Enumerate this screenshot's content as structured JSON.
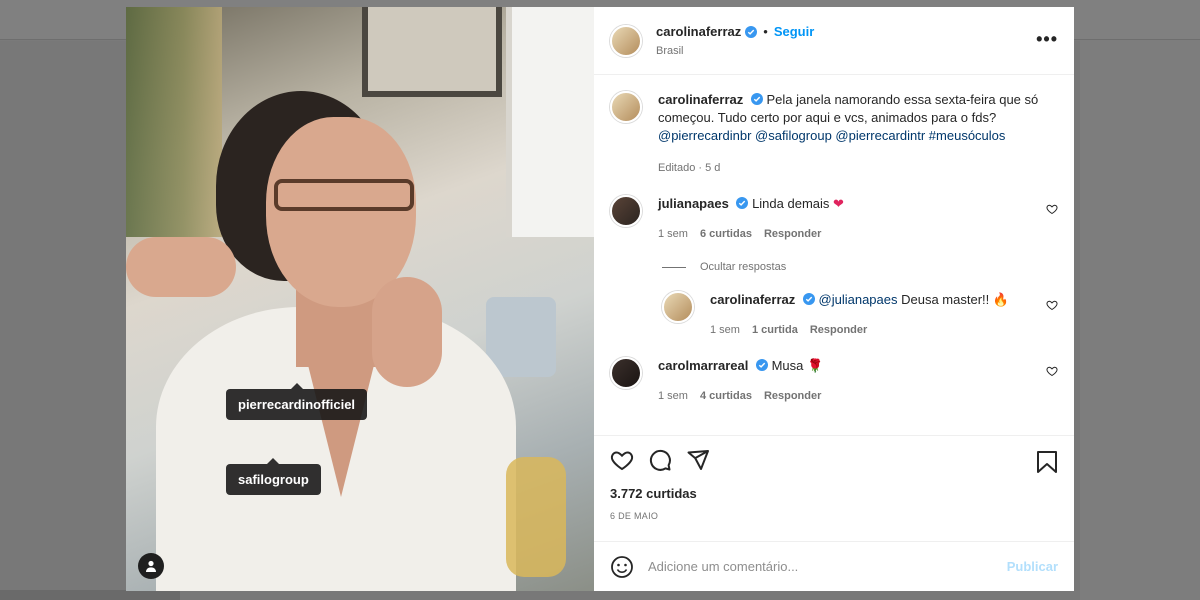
{
  "post": {
    "username": "carolinaferraz",
    "follow_label": "Seguir",
    "location": "Brasil",
    "more_label": "•••",
    "caption": "Pela janela namorando essa sexta-feira que só começou. Tudo certo por aqui e vcs, animados para o fds?",
    "caption_mentions": "@pierrecardinbr @safilogroup @pierrecardintr #meusóculos",
    "caption_meta": "Editado · 5 d",
    "tags": [
      {
        "label": "pierrecardinofficiel"
      },
      {
        "label": "safilogroup"
      }
    ]
  },
  "comments": [
    {
      "username": "julianapaes",
      "text": "Linda demais",
      "emoji": "❤",
      "time": "1 sem",
      "likes": "6 curtidas",
      "reply": "Responder",
      "hide_replies": "Ocultar respostas",
      "replies": [
        {
          "username": "carolinaferraz",
          "mention": "@julianapaes",
          "text": " Deusa master!! 🔥",
          "time": "1 sem",
          "likes": "1 curtida",
          "reply": "Responder"
        }
      ]
    },
    {
      "username": "carolmarrareal",
      "text": "Musa 🌹",
      "time": "1 sem",
      "likes": "4 curtidas",
      "reply": "Responder"
    }
  ],
  "actions": {
    "likes_count": "3.772 curtidas",
    "date": "6 DE MAIO"
  },
  "composer": {
    "placeholder": "Adicione um comentário...",
    "publish_label": "Publicar"
  },
  "icons": {
    "verified": "verified-badge-icon",
    "heart": "heart-icon",
    "comment": "comment-icon",
    "share": "share-icon",
    "bookmark": "bookmark-icon",
    "emoji": "emoji-icon",
    "user": "user-tag-icon"
  },
  "colors": {
    "accent": "#0095f6",
    "publish_disabled": "#b2dffc",
    "verified": "#3897f0"
  }
}
